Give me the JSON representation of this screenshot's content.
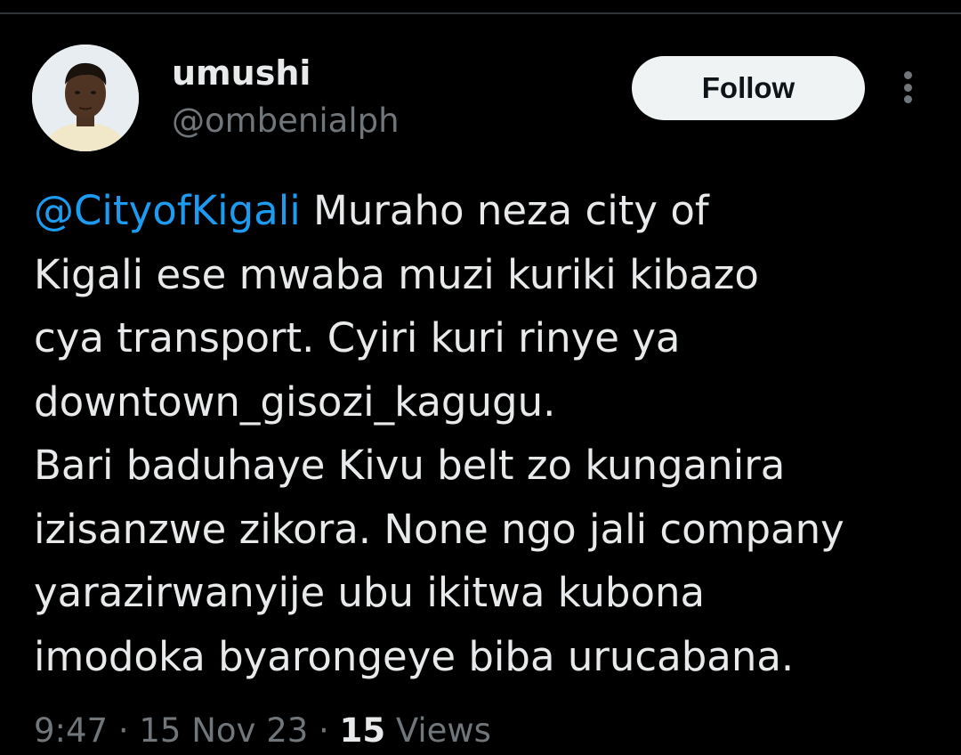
{
  "author": {
    "display_name": "umushi",
    "handle": "@ombenialph"
  },
  "follow_button": {
    "label": "Follow"
  },
  "tweet": {
    "mention": "@CityofKigali",
    "text": " Muraho neza city of\nKigali ese mwaba muzi kuriki kibazo\ncya transport. Cyiri kuri rinye ya\ndowntown_gisozi_kagugu.\nBari baduhaye Kivu belt zo kunganira\nizisanzwe zikora. None ngo jali company\nyarazirwanyije ubu ikitwa kubona\nimodoka byarongeye biba urucabana."
  },
  "meta": {
    "time": "9:47",
    "separator": " · ",
    "date": "15 Nov 23",
    "views_count": "15",
    "views_label": " Views"
  },
  "colors": {
    "background": "#000000",
    "text_primary": "#e7e9ea",
    "text_secondary": "#71767b",
    "link": "#1d9bf0",
    "follow_button_bg": "#eff3f4"
  },
  "icons": {
    "more": "more-vertical-icon"
  }
}
